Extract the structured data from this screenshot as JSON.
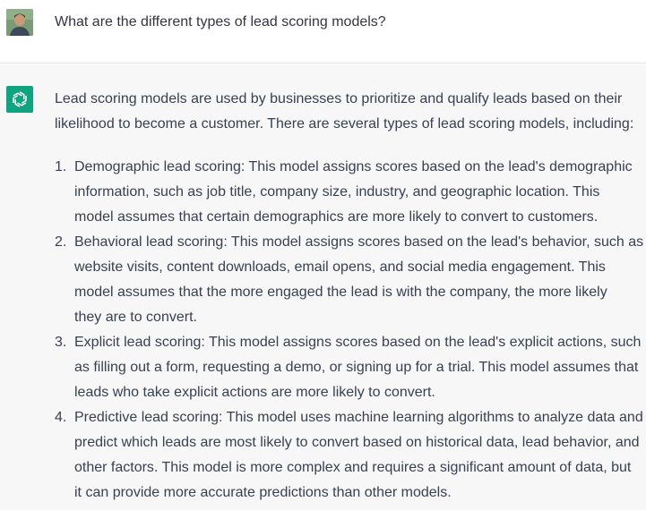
{
  "user_message": {
    "text": "What are the different types of lead scoring models?"
  },
  "assistant_message": {
    "intro_lines": [
      "Lead scoring models are used by businesses to prioritize and qualify leads based on their",
      "likelihood to become a customer. There are several types of lead scoring models, including:"
    ],
    "items": [
      {
        "number": "1.",
        "lines": [
          "Demographic lead scoring: This model assigns scores based on the lead's demographic",
          "information, such as job title, company size, industry, and geographic location. This",
          "model assumes that certain demographics are more likely to convert to customers."
        ]
      },
      {
        "number": "2.",
        "lines": [
          "Behavioral lead scoring: This model assigns scores based on the lead's behavior, such as",
          "website visits, content downloads, email opens, and social media engagement. This",
          "model assumes that the more engaged the lead is with the company, the more likely",
          "they are to convert."
        ]
      },
      {
        "number": "3.",
        "lines": [
          "Explicit lead scoring: This model assigns scores based on the lead's explicit actions, such",
          "as filling out a form, requesting a demo, or signing up for a trial. This model assumes that",
          "leads who take explicit actions are more likely to convert."
        ]
      },
      {
        "number": "4.",
        "lines": [
          "Predictive lead scoring: This model uses machine learning algorithms to analyze data and",
          "predict which leads are most likely to convert based on historical data, lead behavior, and",
          "other factors. This model is more complex and requires a significant amount of data, but",
          "it can provide more accurate predictions than other models."
        ]
      }
    ]
  },
  "colors": {
    "assistant_background": "#f7f7f8",
    "brand_green": "#10a37f",
    "text": "#374151"
  },
  "icons": {
    "user_avatar": "user-avatar",
    "assistant_avatar": "openai-logo-icon"
  }
}
